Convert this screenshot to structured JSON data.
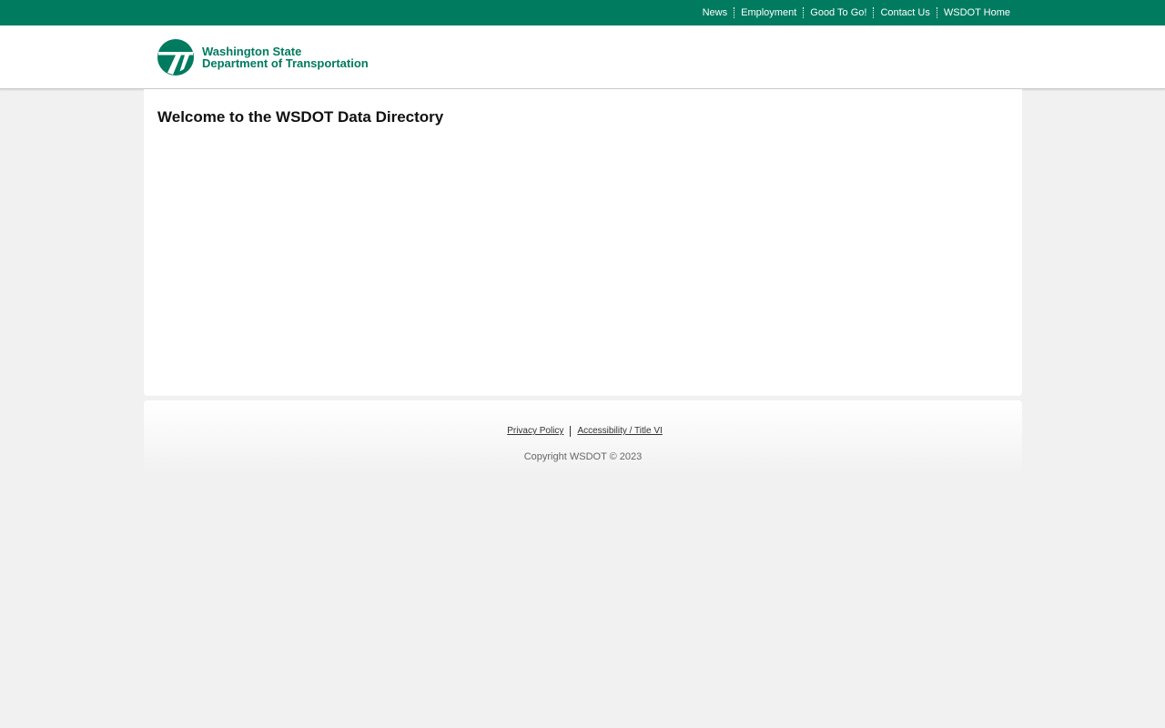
{
  "top_nav": {
    "items": [
      {
        "label": "News"
      },
      {
        "label": "Employment"
      },
      {
        "label": "Good To Go!"
      },
      {
        "label": "Contact Us"
      },
      {
        "label": "WSDOT Home"
      }
    ]
  },
  "header": {
    "logo": {
      "line1": "Washington State",
      "line2": "Department of Transportation",
      "icon": "wsdot-logo-icon"
    }
  },
  "main": {
    "title": "Welcome to the WSDOT Data Directory"
  },
  "footer": {
    "links": [
      {
        "label": "Privacy Policy"
      },
      {
        "label": "Accessibility / Title VI"
      }
    ],
    "copyright": "Copyright WSDOT © 2023"
  },
  "colors": {
    "brand_green": "#007b5f",
    "page_background": "#f1f1f1"
  }
}
